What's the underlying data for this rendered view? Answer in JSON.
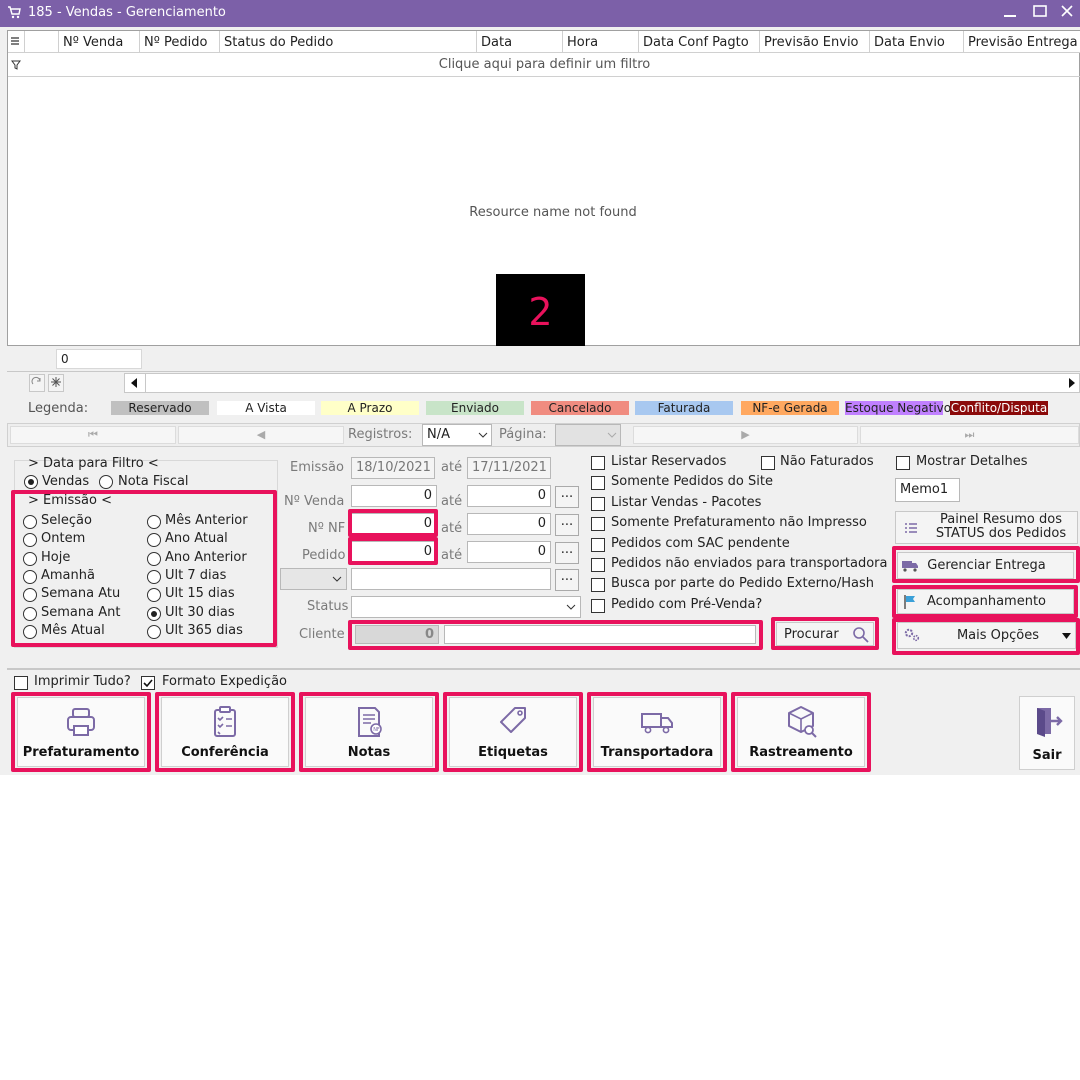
{
  "window": {
    "title": "185 - Vendas - Gerenciamento"
  },
  "grid": {
    "columns": [
      "Nº Venda",
      "Nº Pedido",
      "Status do Pedido",
      "Data",
      "Hora",
      "Data Conf Pagto",
      "Previsão Envio",
      "Data Envio",
      "Previsão Entrega"
    ],
    "filter_hint": "Clique aqui para definir um filtro",
    "message": "Resource name not found",
    "footer_count": "0"
  },
  "annotation": {
    "number": "2"
  },
  "legend": {
    "label": "Legenda:",
    "items": [
      {
        "text": "Reservado",
        "bg": "#c0c0c0",
        "fg": "#222222"
      },
      {
        "text": "A Vista",
        "bg": "#ffffff",
        "fg": "#222222"
      },
      {
        "text": "A Prazo",
        "bg": "#ffffc8",
        "fg": "#222222"
      },
      {
        "text": "Enviado",
        "bg": "#c8e4c8",
        "fg": "#222222"
      },
      {
        "text": "Cancelado",
        "bg": "#f08c80",
        "fg": "#222222"
      },
      {
        "text": "Faturada",
        "bg": "#a8c8f0",
        "fg": "#222222"
      },
      {
        "text": "NF-e Gerada",
        "bg": "#ffa860",
        "fg": "#222222"
      },
      {
        "text": "Estoque Negativo",
        "bg": "#c080ff",
        "fg": "#222222"
      },
      {
        "text": "Conflito/Disputa",
        "bg": "#8b0a0a",
        "fg": "#ffffff"
      }
    ]
  },
  "nav": {
    "registros_label": "Registros:",
    "registros_value": "N/A",
    "pagina_label": "Página:"
  },
  "filters": {
    "data_para_filtro": "> Data para Filtro <",
    "source_options": [
      "Vendas",
      "Nota Fiscal"
    ],
    "emissao_title": "> Emissão <",
    "periods_left": [
      "Seleção",
      "Ontem",
      "Hoje",
      "Amanhã",
      "Semana Atu",
      "Semana Ant",
      "Mês Atual"
    ],
    "periods_right": [
      "Mês Anterior",
      "Ano Atual",
      "Ano Anterior",
      "Ult 7 dias",
      "Ult 15 dias",
      "Ult 30 dias",
      "Ult 365 dias"
    ],
    "selected_period": "Ult 30 dias"
  },
  "fields": {
    "emissao_label": "Emissão",
    "emissao_from": "18/10/2021",
    "emissao_to": "17/11/2021",
    "ate": "até",
    "venda_label": "Nº Venda",
    "venda_from": "0",
    "venda_to": "0",
    "nf_label": "Nº NF",
    "nf_from": "0",
    "nf_to": "0",
    "pedido_label": "Pedido",
    "pedido_from": "0",
    "pedido_to": "0",
    "status_label": "Status",
    "cliente_label": "Cliente",
    "cliente_code": "0",
    "procurar": "Procurar",
    "dots": "..."
  },
  "checks": [
    "Listar Reservados",
    "Somente Pedidos do Site",
    "Listar Vendas - Pacotes",
    "Somente Prefaturamento não Impresso",
    "Pedidos com SAC pendente",
    "Pedidos não enviados para transportadora",
    "Busca por parte do Pedido Externo/Hash",
    "Pedido com Pré-Venda?"
  ],
  "nao_faturados": "Não Faturados",
  "mostrar_detalhes": "Mostrar Detalhes",
  "memo": "Memo1",
  "side_buttons": {
    "painel_line1": "Painel Resumo dos",
    "painel_line2": "STATUS dos Pedidos",
    "gerenciar": "Gerenciar Entrega",
    "acompanhamento": "Acompanhamento",
    "mais_opcoes": "Mais Opções"
  },
  "print_options": {
    "imprimir_tudo": "Imprimir Tudo?",
    "formato_expedicao": "Formato Expedição"
  },
  "actions": [
    "Prefaturamento",
    "Conferência",
    "Notas",
    "Etiquetas",
    "Transportadora",
    "Rastreamento"
  ],
  "sair": "Sair",
  "colors": {
    "titlebar": "#7c60a8",
    "highlight": "#e8125c",
    "icon": "#7c6aa6"
  }
}
